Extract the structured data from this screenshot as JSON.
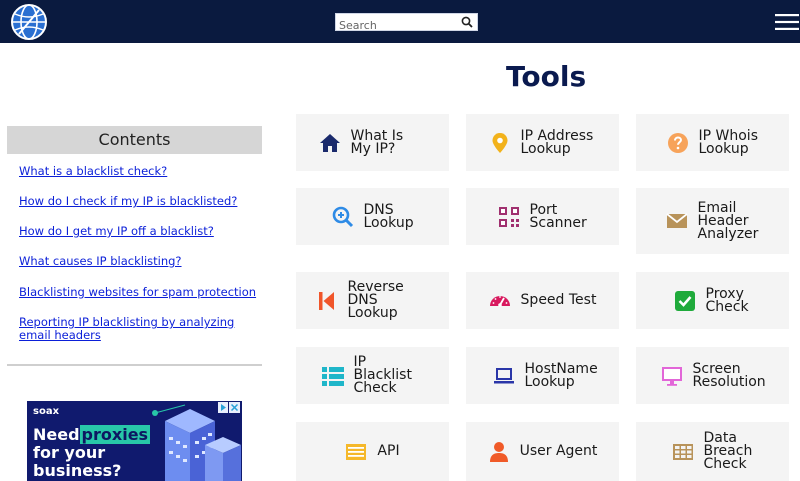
{
  "header": {
    "search": {
      "placeholder": "Search"
    }
  },
  "page": {
    "title": "Tools"
  },
  "contents": {
    "heading": "Contents",
    "links": [
      "What is a blacklist check?",
      "How do I check if my IP is blacklisted?",
      "How do I get my IP off a blacklist?",
      "What causes IP blacklisting?",
      "Blacklisting websites for spam protection",
      "Reporting IP blacklisting by analyzing email headers"
    ]
  },
  "ad": {
    "brand": "soax",
    "line1a": "Need",
    "line1b": "proxies",
    "line2": "for your",
    "line3": "business?"
  },
  "tools": [
    {
      "label": "What Is My IP?",
      "icon": "home-icon"
    },
    {
      "label": "IP Address Lookup",
      "icon": "map-pin-icon"
    },
    {
      "label": "IP Whois Lookup",
      "icon": "question-icon"
    },
    {
      "label": "DNS Lookup",
      "icon": "magnify-plus-icon"
    },
    {
      "label": "Port Scanner",
      "icon": "qr-code-icon"
    },
    {
      "label": "Email Header Analyzer",
      "icon": "envelope-icon"
    },
    {
      "label": "Reverse DNS Lookup",
      "icon": "rewind-icon"
    },
    {
      "label": "Speed Test",
      "icon": "speedometer-icon"
    },
    {
      "label": "Proxy Check",
      "icon": "checkbox-icon"
    },
    {
      "label": "IP Blacklist Check",
      "icon": "list-icon"
    },
    {
      "label": "HostName Lookup",
      "icon": "laptop-icon"
    },
    {
      "label": "Screen Resolution",
      "icon": "monitor-icon"
    },
    {
      "label": "API",
      "icon": "document-lines-icon"
    },
    {
      "label": "User Agent",
      "icon": "user-icon"
    },
    {
      "label": "Data Breach Check",
      "icon": "grid-table-icon"
    }
  ],
  "colors": {
    "header_bg": "#0a1a3f",
    "title": "#0a1a4f",
    "link": "#0b1fd8",
    "card_bg": "#f4f4f4"
  }
}
